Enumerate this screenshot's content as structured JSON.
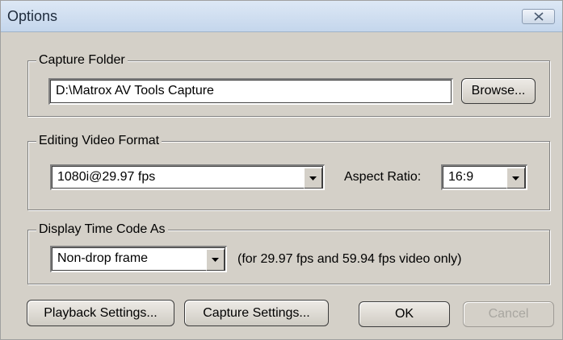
{
  "window": {
    "title": "Options",
    "close_icon": "close-icon"
  },
  "capture_folder": {
    "legend": "Capture Folder",
    "path_value": "D:\\Matrox AV Tools Capture",
    "browse_label": "Browse..."
  },
  "editing_video_format": {
    "legend": "Editing Video Format",
    "format_value": "1080i@29.97 fps",
    "aspect_label": "Aspect Ratio:",
    "aspect_value": "16:9"
  },
  "display_time_code": {
    "legend": "Display Time Code As",
    "mode_value": "Non-drop frame",
    "note": "(for 29.97 fps and 59.94 fps video only)"
  },
  "footer": {
    "playback_label": "Playback Settings...",
    "capture_label": "Capture Settings...",
    "ok_label": "OK",
    "cancel_label": "Cancel"
  }
}
